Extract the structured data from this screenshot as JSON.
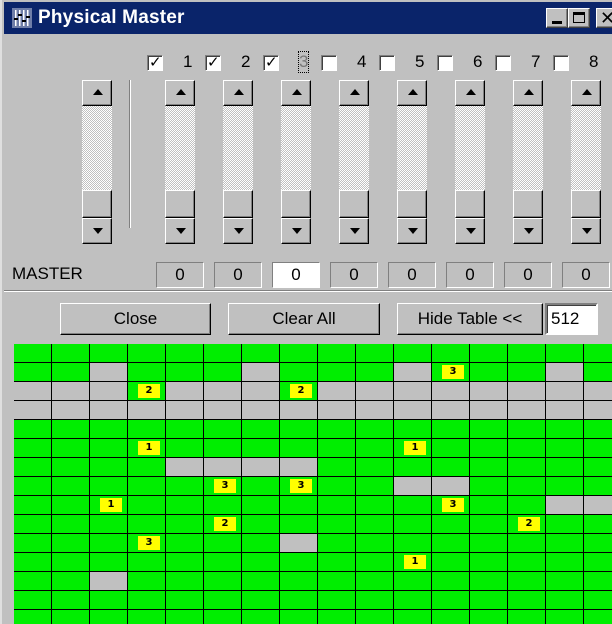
{
  "window": {
    "title": "Physical Master",
    "icon": "fader-app-icon",
    "controls": {
      "minimize": "minimize-icon",
      "maximize": "maximize-icon",
      "close": "close-icon"
    }
  },
  "channels": [
    {
      "label": "1",
      "checked": true,
      "value": "0"
    },
    {
      "label": "2",
      "checked": true,
      "value": "0"
    },
    {
      "label": "3",
      "checked": true,
      "value": "0",
      "focused": true,
      "active": true
    },
    {
      "label": "4",
      "checked": false,
      "value": "0"
    },
    {
      "label": "5",
      "checked": false,
      "value": "0"
    },
    {
      "label": "6",
      "checked": false,
      "value": "0"
    },
    {
      "label": "7",
      "checked": false,
      "value": "0"
    },
    {
      "label": "8",
      "checked": false,
      "value": "0"
    }
  ],
  "master": {
    "label": "MASTER"
  },
  "buttons": {
    "close": "Close",
    "clear_all": "Clear All",
    "hide_table": "Hide Table <<"
  },
  "channel_count": "512",
  "table": {
    "columns": 16,
    "colors": {
      "empty": "#00ee00",
      "used": "#c0c0c0",
      "marker": "#ffff00"
    },
    "rows": [
      [
        0,
        0,
        0,
        0,
        0,
        0,
        0,
        0,
        0,
        0,
        0,
        0,
        0,
        0,
        0,
        0
      ],
      [
        0,
        0,
        "g",
        0,
        0,
        0,
        "g",
        0,
        0,
        0,
        "g",
        "3",
        0,
        0,
        "g",
        0
      ],
      [
        "g",
        "g",
        "g",
        "2",
        "g",
        "g",
        "g",
        "2",
        "g",
        "g",
        "g",
        "g",
        "g",
        "g",
        "g",
        "g"
      ],
      [
        "g",
        "g",
        "g",
        "g",
        "g",
        "g",
        "g",
        "g",
        "g",
        "g",
        "g",
        "g",
        "g",
        "g",
        "g",
        "g"
      ],
      [
        0,
        0,
        0,
        0,
        0,
        0,
        0,
        0,
        0,
        0,
        0,
        0,
        0,
        0,
        0,
        0
      ],
      [
        0,
        0,
        0,
        "1",
        0,
        0,
        0,
        0,
        0,
        0,
        "1",
        0,
        0,
        0,
        0,
        0
      ],
      [
        0,
        0,
        0,
        0,
        "g",
        "g",
        "g",
        "g",
        0,
        0,
        0,
        0,
        0,
        0,
        0,
        0
      ],
      [
        0,
        0,
        0,
        0,
        0,
        "3",
        0,
        "3",
        0,
        0,
        "g",
        "g",
        0,
        0,
        0,
        0
      ],
      [
        0,
        0,
        "1",
        0,
        0,
        0,
        0,
        0,
        0,
        0,
        0,
        "3",
        0,
        0,
        "g",
        "g"
      ],
      [
        0,
        0,
        0,
        0,
        0,
        "2",
        0,
        0,
        0,
        0,
        0,
        0,
        0,
        "2",
        0,
        0
      ],
      [
        0,
        0,
        0,
        "3",
        0,
        0,
        0,
        "g",
        0,
        0,
        0,
        0,
        0,
        0,
        0,
        0
      ],
      [
        0,
        0,
        0,
        0,
        0,
        0,
        0,
        0,
        0,
        0,
        "1",
        0,
        0,
        0,
        0,
        0
      ],
      [
        0,
        0,
        "g",
        0,
        0,
        0,
        0,
        0,
        0,
        0,
        0,
        0,
        0,
        0,
        0,
        0
      ],
      [
        0,
        0,
        0,
        0,
        0,
        0,
        0,
        0,
        0,
        0,
        0,
        0,
        0,
        0,
        0,
        0
      ],
      [
        0,
        0,
        0,
        0,
        0,
        0,
        0,
        0,
        0,
        0,
        0,
        0,
        0,
        0,
        0,
        0
      ]
    ]
  }
}
